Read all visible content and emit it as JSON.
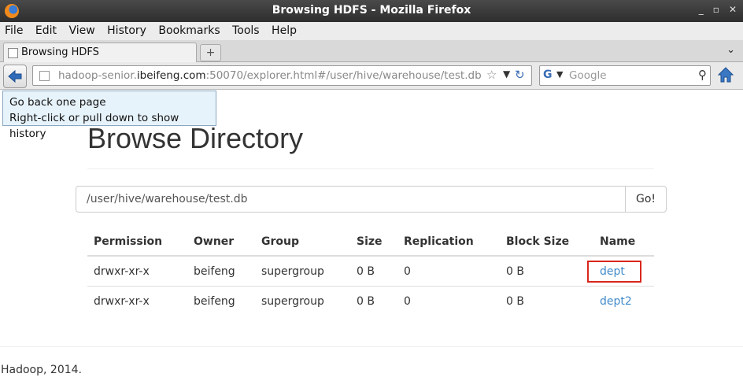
{
  "window": {
    "title": "Browsing HDFS - Mozilla Firefox",
    "controls": [
      "_",
      "▫",
      "✕"
    ]
  },
  "menu": [
    "File",
    "Edit",
    "View",
    "History",
    "Bookmarks",
    "Tools",
    "Help"
  ],
  "tab": {
    "title": "Browsing HDFS",
    "new_tab": "+",
    "list_toggle": "⌄"
  },
  "nav": {
    "url_host_prefix": "hadoop-senior.",
    "url_host_domain": "ibeifeng.com",
    "url_rest": ":50070/explorer.html#/user/hive/warehouse/test.db",
    "search_placeholder": "Google",
    "search_engine_icon": "G"
  },
  "tooltip": {
    "line1": "Go back one page",
    "line2": "Right-click or pull down to show history"
  },
  "page": {
    "title": "Browse Directory",
    "path_value": "/user/hive/warehouse/test.db",
    "go_label": "Go!",
    "columns": [
      "Permission",
      "Owner",
      "Group",
      "Size",
      "Replication",
      "Block Size",
      "Name"
    ],
    "rows": [
      [
        "drwxr-xr-x",
        "beifeng",
        "supergroup",
        "0 B",
        "0",
        "0 B",
        "dept"
      ],
      [
        "drwxr-xr-x",
        "beifeng",
        "supergroup",
        "0 B",
        "0",
        "0 B",
        "dept2"
      ]
    ],
    "footer": "Hadoop, 2014."
  },
  "colors": {
    "link": "#428bca",
    "highlight": "#d9261c"
  }
}
